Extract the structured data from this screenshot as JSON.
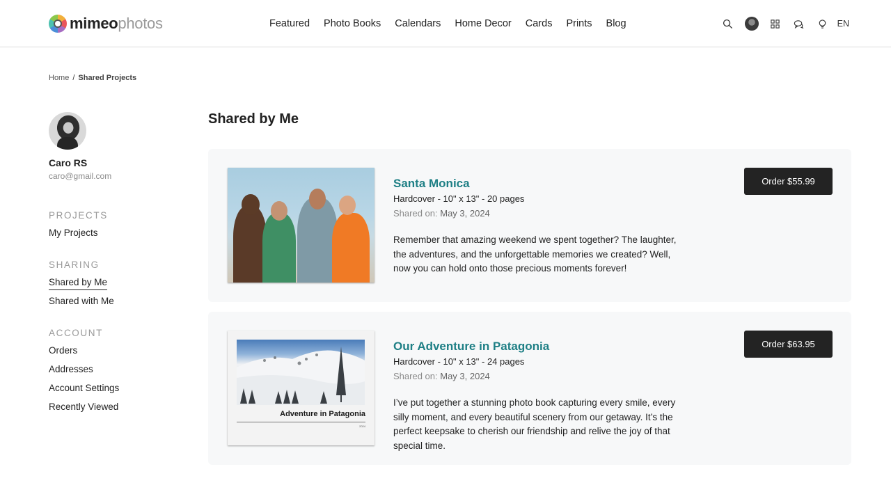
{
  "brand": {
    "name_bold": "mimeo",
    "name_light": "photos",
    "accent": "#1e7f85"
  },
  "nav": {
    "items": [
      "Featured",
      "Photo Books",
      "Calendars",
      "Home Decor",
      "Cards",
      "Prints",
      "Blog"
    ]
  },
  "header_icons": {
    "search": "search-icon",
    "account": "user-avatar",
    "apps": "grid-icon",
    "chat": "chat-icon",
    "help": "lightbulb-icon",
    "language": "EN"
  },
  "breadcrumb": {
    "home": "Home",
    "separator": "/",
    "current": "Shared Projects"
  },
  "profile": {
    "name": "Caro RS",
    "email": "caro@gmail.com"
  },
  "sidebar": {
    "sections": [
      {
        "heading": "PROJECTS",
        "items": [
          "My Projects"
        ]
      },
      {
        "heading": "SHARING",
        "items": [
          "Shared by Me",
          "Shared with Me"
        ],
        "active": "Shared by Me"
      },
      {
        "heading": "ACCOUNT",
        "items": [
          "Orders",
          "Addresses",
          "Account Settings",
          "Recently Viewed"
        ]
      }
    ]
  },
  "main": {
    "title": "Shared by Me",
    "projects": [
      {
        "title": "Santa Monica",
        "spec": "Hardcover - 10\" x 13\" - 20 pages",
        "shared_label": "Shared on:",
        "shared_date": "May 3, 2024",
        "description": "Remember that amazing weekend we spent together? The laughter, the adventures, and the unforgettable memories we created? Well, now you can hold onto those precious moments forever!",
        "order_label": "Order $55.99"
      },
      {
        "title": "Our Adventure in Patagonia",
        "spec": "Hardcover - 10\" x 13\" - 24 pages",
        "shared_label": "Shared on:",
        "shared_date": "May 3, 2024",
        "description": "I’ve put together a stunning photo book capturing every smile, every silly moment, and every beautiful scenery from our getaway. It’s the perfect keepsake to cherish our friendship and relive the joy of that special time.",
        "order_label": "Order $63.95",
        "cover_title": "Adventure in Patagonia",
        "cover_year": "2024"
      }
    ]
  }
}
